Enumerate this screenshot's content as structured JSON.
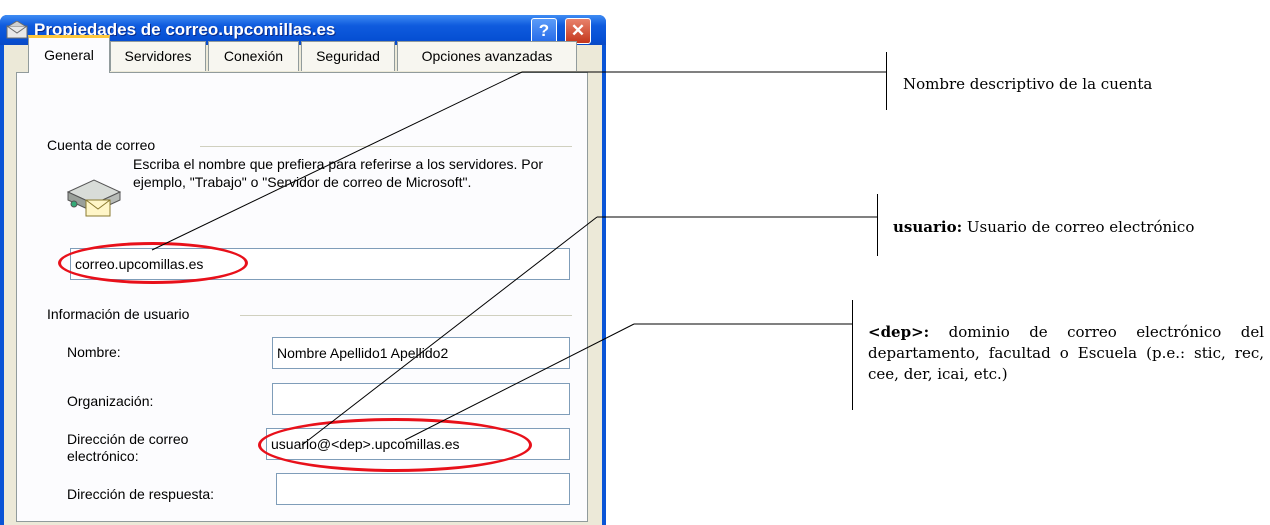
{
  "dialog": {
    "title": "Propiedades de correo.upcomillas.es",
    "help_label": "?",
    "close_label": "✕",
    "tabs": [
      {
        "label": "General",
        "active": true
      },
      {
        "label": "Servidores",
        "active": false
      },
      {
        "label": "Conexión",
        "active": false
      },
      {
        "label": "Seguridad",
        "active": false
      },
      {
        "label": "Opciones avanzadas",
        "active": false
      }
    ],
    "mail_account": {
      "group_label": "Cuenta de correo",
      "description": "Escriba el nombre que prefiera para referirse a los servidores. Por ejemplo, \"Trabajo\" o \"Servidor de correo de Microsoft\".",
      "account_name_value": "correo.upcomillas.es"
    },
    "user_info": {
      "group_label": "Información de usuario",
      "name_label": "Nombre:",
      "name_value": "Nombre Apellido1 Apellido2",
      "organization_label": "Organización:",
      "organization_value": "",
      "email_label": "Dirección de correo electrónico:",
      "email_value": "usuario@<dep>.upcomillas.es",
      "reply_label": "Dirección de respuesta:",
      "reply_value": ""
    }
  },
  "annotations": {
    "account_note": "Nombre descriptivo de la cuenta",
    "user_note_bold": "usuario:",
    "user_note": " Usuario de correo electrónico",
    "dep_note_bold": "<dep>:",
    "dep_note": " dominio de correo electrónico del departamento, facultad o Escuela (p.e.: stic, rec, cee, der, icai, etc.)"
  },
  "colors": {
    "titlebar": "#0a54d6",
    "highlight_ellipse": "#e8101a",
    "active_tab_accent": "#ffc83c"
  }
}
